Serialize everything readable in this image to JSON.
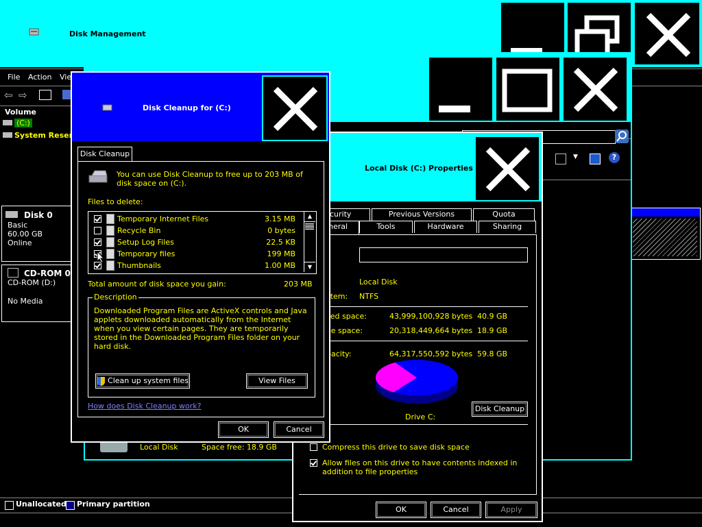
{
  "disk_mgmt": {
    "title": "Disk Management",
    "menu": [
      "File",
      "Action",
      "Vie"
    ],
    "volume_header": "Volume",
    "volumes": [
      "(C:)",
      "System Reserv"
    ],
    "disk0": {
      "name": "Disk 0",
      "type": "Basic",
      "size": "60.00 GB",
      "status": "Online"
    },
    "cdrom0": {
      "name": "CD-ROM 0",
      "label": "CD-ROM (D:)",
      "status": "No Media"
    },
    "legend": {
      "unallocated": "Unallocated",
      "primary": "Primary partition"
    }
  },
  "explorer_window": {
    "bottom_label": "Local Disk",
    "bottom_space": "Space free: 18.9 GB"
  },
  "cleanup": {
    "title": "Disk Cleanup for  (C:)",
    "tab": "Disk Cleanup",
    "intro": "You can use Disk Cleanup to free up to 203 MB of disk space on  (C:).",
    "files_label": "Files to delete:",
    "files": [
      {
        "name": "Temporary Internet Files",
        "size": "3.15 MB",
        "checked": true
      },
      {
        "name": "Recycle Bin",
        "size": "0 bytes",
        "checked": false
      },
      {
        "name": "Setup Log Files",
        "size": "22.5 KB",
        "checked": true
      },
      {
        "name": "Temporary files",
        "size": "199 MB",
        "checked": true
      },
      {
        "name": "Thumbnails",
        "size": "1.00 MB",
        "checked": true
      }
    ],
    "total_label": "Total amount of disk space you gain:",
    "total_value": "203 MB",
    "description_label": "Description",
    "description": "Downloaded Program Files are ActiveX controls and Java applets downloaded automatically from the Internet when you view certain pages. They are temporarily stored in the Downloaded Program Files folder on your hard disk.",
    "cleanup_system_button": "Clean up system files",
    "view_files_button": "View Files",
    "how_link": "How does Disk Cleanup work?",
    "ok": "OK",
    "cancel": "Cancel"
  },
  "properties": {
    "title": "Local Disk (C:) Properties",
    "tabs_row1": [
      "curity",
      "Previous Versions",
      "Quota"
    ],
    "tabs_row2": [
      "neral",
      "Tools",
      "Hardware",
      "Sharing"
    ],
    "type_value": "Local Disk",
    "fs_label": "stem:",
    "fs_value": "NTFS",
    "used_label": "sed space:",
    "used_bytes": "43,999,100,928 bytes",
    "used_gb": "40.9 GB",
    "free_label": "ee space:",
    "free_bytes": "20,318,449,664 bytes",
    "free_gb": "18.9 GB",
    "cap_label": "pacity:",
    "cap_bytes": "64,317,550,592 bytes",
    "cap_gb": "59.8 GB",
    "drive_label": "Drive C:",
    "cleanup_button": "Disk Cleanup",
    "compress_label": "Compress this drive to save disk space",
    "index_label": "Allow files on this drive to have contents indexed in addition to file properties",
    "ok": "OK",
    "cancel": "Cancel",
    "apply": "Apply",
    "used_fraction": 0.684,
    "colors": {
      "used": "#0000ff",
      "free": "#ff00ff"
    }
  }
}
